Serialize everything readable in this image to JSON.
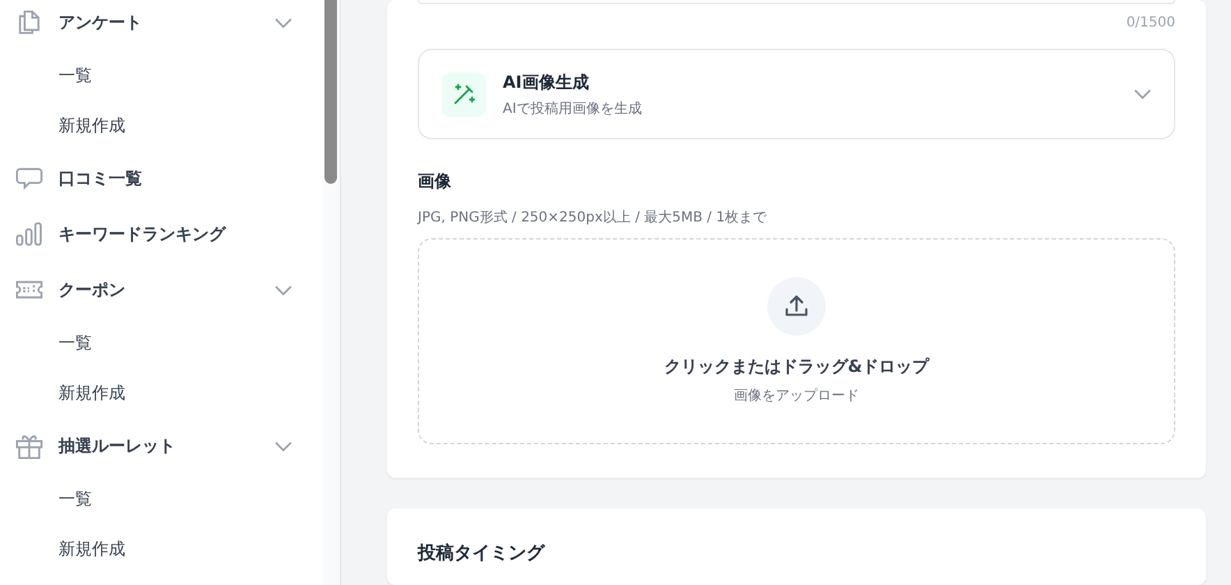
{
  "sidebar": {
    "items": [
      {
        "kind": "group",
        "label": "アンケート",
        "expanded": true,
        "children": [
          {
            "label": "一覧"
          },
          {
            "label": "新規作成"
          }
        ]
      },
      {
        "kind": "link",
        "label": "口コミ一覧"
      },
      {
        "kind": "link",
        "label": "キーワードランキング"
      },
      {
        "kind": "group",
        "label": "クーポン",
        "expanded": true,
        "children": [
          {
            "label": "一覧"
          },
          {
            "label": "新規作成"
          }
        ]
      },
      {
        "kind": "group",
        "label": "抽選ルーレット",
        "expanded": true,
        "children": [
          {
            "label": "一覧"
          },
          {
            "label": "新規作成"
          }
        ]
      }
    ]
  },
  "post_card": {
    "char_count": "0/1500",
    "ai_panel": {
      "title": "AI画像生成",
      "subtitle": "AIで投稿用画像を生成",
      "expanded": false
    },
    "image": {
      "label": "画像",
      "hint": "JPG, PNG形式 / 250×250px以上 / 最大5MB / 1枚まで",
      "dropzone_title": "クリックまたはドラッグ&ドロップ",
      "dropzone_subtitle": "画像をアップロード"
    }
  },
  "timing_card": {
    "title": "投稿タイミング"
  }
}
